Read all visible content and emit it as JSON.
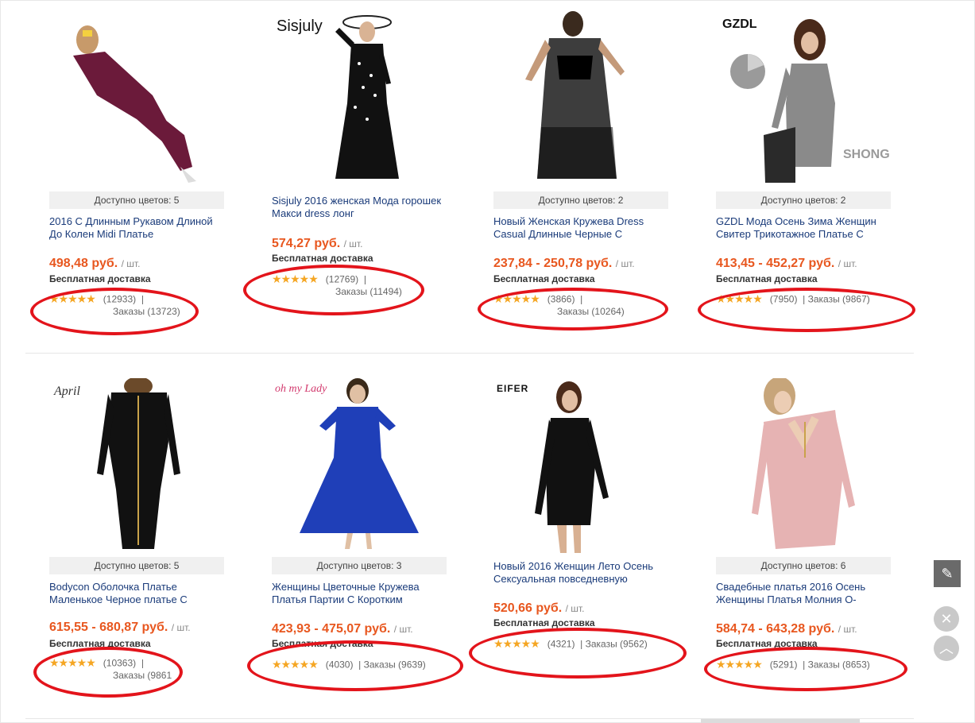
{
  "colors": {
    "accent_price": "#e8571f",
    "ring": "#e3141b",
    "title_link": "#1a3b7a",
    "star": "#f5a623"
  },
  "products": [
    {
      "brand": "",
      "colors_text": "Доступно цветов: 5",
      "title": "2016 С Длинным Рукавом Длиной До Колен Midi Платье",
      "price": "498,48 руб.",
      "unit": "/ шт.",
      "shipping": "Бесплатная доставка",
      "stars": "★★★★★",
      "reviews": "(12933)",
      "separator": "|",
      "orders": "Заказы (13723)"
    },
    {
      "brand": "Sisjuly",
      "colors_text": "",
      "title": "Sisjuly 2016 женская Мода горошек Макси dress лонг",
      "price": "574,27 руб.",
      "unit": "/ шт.",
      "shipping": "Бесплатная доставка",
      "stars": "★★★★★",
      "reviews": "(12769)",
      "separator": "|",
      "orders": "Заказы (11494)"
    },
    {
      "brand": "",
      "colors_text": "Доступно цветов: 2",
      "title": "Новый Женская Кружева Dress Casual Длинные Черные С",
      "price": "237,84 - 250,78 руб.",
      "unit": "/ шт.",
      "shipping": "Бесплатная доставка",
      "stars": "★★★★★",
      "reviews": "(3866)",
      "separator": "|",
      "orders": "Заказы (10264)"
    },
    {
      "brand": "GZDL",
      "colors_text": "Доступно цветов: 2",
      "title": "GZDL Мода Осень Зима Женщин Свитер Трикотажное Платье С",
      "price": "413,45 - 452,27 руб.",
      "unit": "/ шт.",
      "shipping": "Бесплатная доставка",
      "stars": "★★★★★",
      "reviews": "(7950)",
      "separator": "|",
      "orders": "Заказы (9867)"
    },
    {
      "brand": "April",
      "colors_text": "Доступно цветов: 5",
      "title": "Bodycon Оболочка Платье Маленькое Черное платье С",
      "price": "615,55 - 680,87 руб.",
      "unit": "/ шт.",
      "shipping": "Бесплатная доставка",
      "stars": "★★★★★",
      "reviews": "(10363)",
      "separator": "|",
      "orders": "Заказы (9861"
    },
    {
      "brand": "oh my Lady",
      "colors_text": "Доступно цветов: 3",
      "title": "Женщины Цветочные Кружева Платья Партии С Коротким",
      "price": "423,93 - 475,07 руб.",
      "unit": "/ шт.",
      "shipping": "Бесплатная доставка",
      "stars": "★★★★★",
      "reviews": "(4030)",
      "separator": "|",
      "orders": "Заказы (9639)"
    },
    {
      "brand": "EIFER",
      "colors_text": "",
      "title": "Новый 2016 Женщин Лето Осень Сексуальная повседневную",
      "price": "520,66 руб.",
      "unit": "/ шт.",
      "shipping": "Бесплатная доставка",
      "stars": "★★★★★",
      "reviews": "(4321)",
      "separator": "|",
      "orders": "Заказы (9562)"
    },
    {
      "brand": "",
      "colors_text": "Доступно цветов: 6",
      "title": "Свадебные платья 2016 Осень Женщины Платья Молния О-",
      "price": "584,74 - 643,28 руб.",
      "unit": "/ шт.",
      "shipping": "Бесплатная доставка",
      "stars": "★★★★★",
      "reviews": "(5291)",
      "separator": "|",
      "orders": "Заказы (8653)"
    }
  ],
  "watermark": "SHONG",
  "sidebar": {
    "edit_icon": "pencil-icon",
    "close_icon": "close-icon",
    "up_icon": "chevron-up-icon"
  }
}
